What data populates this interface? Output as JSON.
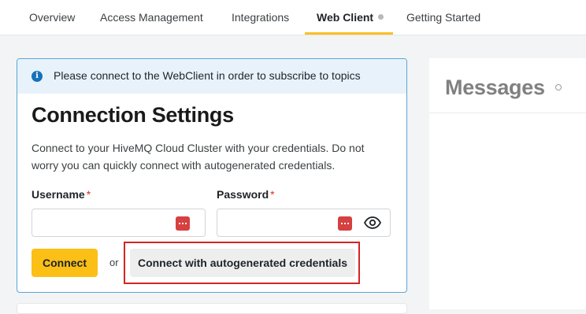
{
  "tabs": [
    {
      "label": "Overview"
    },
    {
      "label": "Access Management"
    },
    {
      "label": "Integrations"
    },
    {
      "label": "Web Client",
      "active": true
    },
    {
      "label": "Getting Started"
    }
  ],
  "banner": {
    "icon": "info-icon",
    "text": "Please connect to the WebClient in order to subscribe to topics"
  },
  "connection": {
    "title": "Connection Settings",
    "description": "Connect to your HiveMQ Cloud Cluster with your credentials. Do not worry you can quickly connect with autogenerated credentials.",
    "username_label": "Username",
    "password_label": "Password",
    "required_marker": "*",
    "username_value": "",
    "password_value": "",
    "connect_label": "Connect",
    "or_label": "or",
    "autogen_label": "Connect with autogenerated credentials"
  },
  "messages": {
    "title": "Messages"
  },
  "colors": {
    "accent": "#fbbf16",
    "info": "#1672b9",
    "highlight": "#d42424",
    "required": "#d93025"
  }
}
